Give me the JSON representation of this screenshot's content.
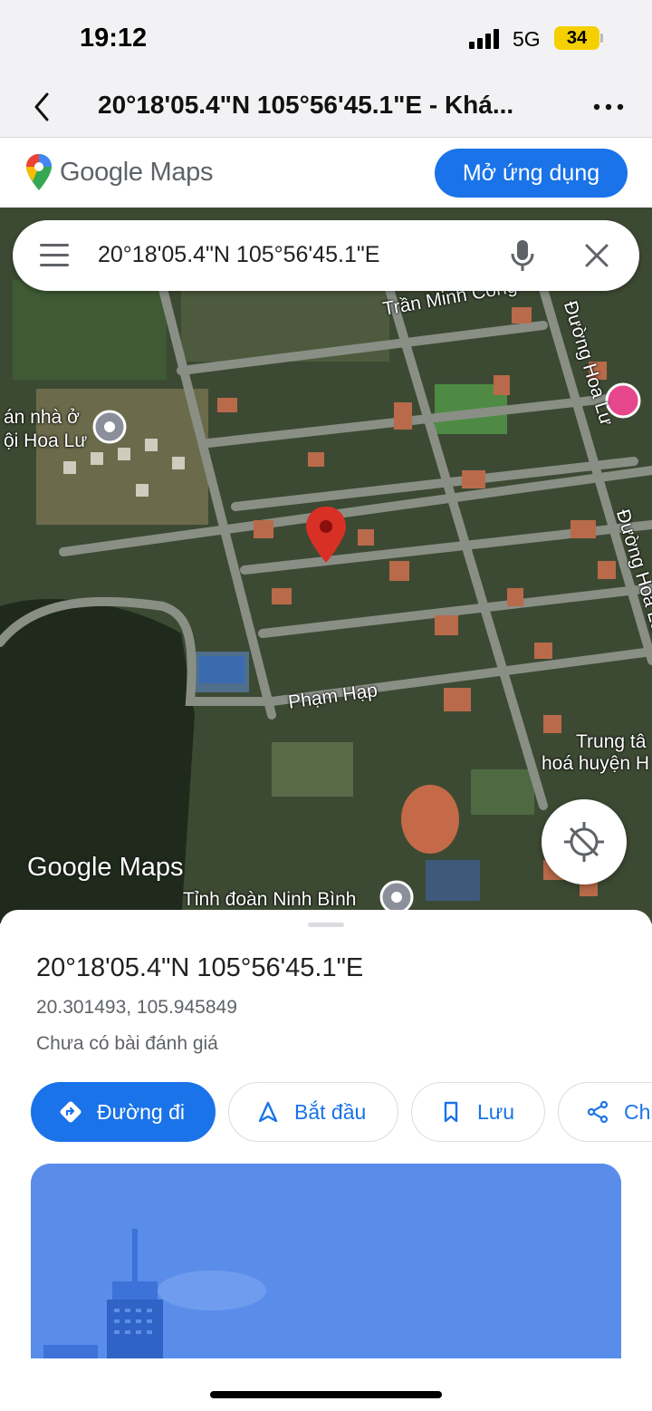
{
  "status_bar": {
    "time": "19:12",
    "network": "5G",
    "battery": "34"
  },
  "browser": {
    "title": "20°18'05.4\"N 105°56'45.1\"E - Khá..."
  },
  "banner": {
    "logo_text": "Google Maps",
    "open_app_label": "Mở ứng dụng"
  },
  "search": {
    "value": "20°18'05.4\"N 105°56'45.1\"E"
  },
  "map": {
    "labels": {
      "tran_minh_cong": "Trần Minh Công",
      "duong_hoa_lu_1": "Đường Hoa Lư",
      "duong_hoa_lu_2": "Đường Hoa Lư",
      "du_an_line1": "án nhà ở",
      "du_an_line2": "ội Hoa Lư",
      "pham_hap": "Phạm Hạp",
      "trung_tam_line1": "Trung tâ",
      "trung_tam_line2": "hoá huyện H",
      "tinh_doan": "Tỉnh đoàn Ninh Bình"
    },
    "watermark": "Google Maps"
  },
  "place": {
    "title": "20°18'05.4\"N 105°56'45.1\"E",
    "decimal": "20.301493, 105.945849",
    "reviews": "Chưa có bài đánh giá"
  },
  "actions": {
    "directions": "Đường đi",
    "start": "Bắt đầu",
    "save": "Lưu",
    "share": "Chi"
  },
  "colors": {
    "accent": "#1a73e8",
    "pin": "#d93025",
    "battery": "#f5d000"
  }
}
